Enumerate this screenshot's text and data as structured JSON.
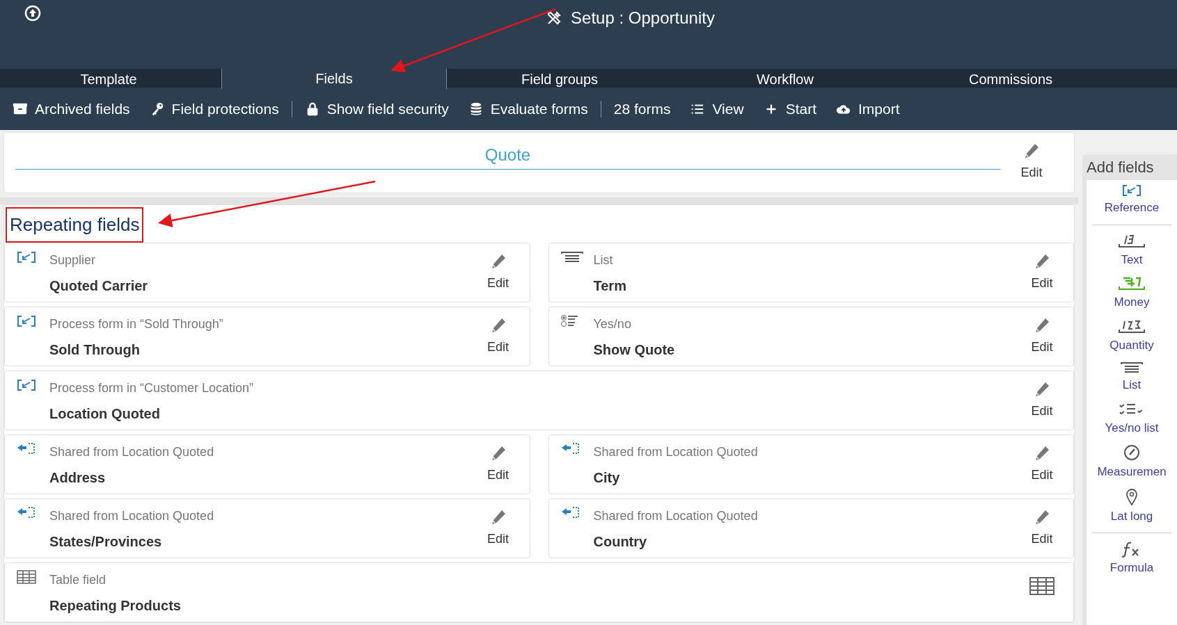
{
  "header": {
    "title": "Setup : Opportunity"
  },
  "tabs": [
    {
      "label": "Template",
      "selected": false
    },
    {
      "label": "Fields",
      "selected": true
    },
    {
      "label": "Field groups",
      "selected": false
    },
    {
      "label": "Workflow",
      "selected": false
    },
    {
      "label": "Commissions",
      "selected": false
    }
  ],
  "toolbar_groups": [
    [
      {
        "label": "Archived fields",
        "kind": "archive"
      },
      {
        "label": "Field protections",
        "kind": "key"
      }
    ],
    [
      {
        "label": "Show field security",
        "kind": "lock"
      },
      {
        "label": "Evaluate forms",
        "kind": "database"
      }
    ],
    [
      {
        "label": "28 forms",
        "kind": "count"
      },
      {
        "label": "View",
        "kind": "list"
      },
      {
        "label": "Start",
        "kind": "plus"
      },
      {
        "label": "Import",
        "kind": "cloud"
      }
    ]
  ],
  "quote_section": {
    "title": "Quote",
    "edit_label": "Edit"
  },
  "repeating_section": {
    "title": "Repeating fields",
    "highlighted": true,
    "fields": [
      {
        "kind": "reference",
        "type_label": "Supplier",
        "name": "Quoted Carrier",
        "edit_label": "Edit",
        "wide": false
      },
      {
        "kind": "list",
        "type_label": "List",
        "name": "Term",
        "edit_label": "Edit",
        "wide": false
      },
      {
        "kind": "reference",
        "type_label": "Process form in “Sold Through”",
        "name": "Sold Through",
        "edit_label": "Edit",
        "wide": false
      },
      {
        "kind": "yesno",
        "type_label": "Yes/no",
        "name": "Show Quote",
        "edit_label": "Edit",
        "wide": false
      },
      {
        "kind": "reference",
        "type_label": "Process form in “Customer Location”",
        "name": "Location Quoted",
        "edit_label": "Edit",
        "wide": true
      },
      {
        "kind": "shared",
        "type_label": "Shared from Location Quoted",
        "name": "Address",
        "edit_label": "Edit",
        "wide": false
      },
      {
        "kind": "shared",
        "type_label": "Shared from Location Quoted",
        "name": "City",
        "edit_label": "Edit",
        "wide": false
      },
      {
        "kind": "shared",
        "type_label": "Shared from Location Quoted",
        "name": "States/Provinces",
        "edit_label": "Edit",
        "wide": false
      },
      {
        "kind": "shared",
        "type_label": "Shared from Location Quoted",
        "name": "Country",
        "edit_label": "Edit",
        "wide": false
      },
      {
        "kind": "table",
        "type_label": "Table field",
        "name": "Repeating Products",
        "wide": true
      }
    ]
  },
  "sidebar": {
    "title": "Add fields",
    "groups": [
      [
        {
          "kind": "reference",
          "label": "Reference"
        }
      ],
      [
        {
          "kind": "text",
          "label": "Text"
        },
        {
          "kind": "money",
          "label": "Money"
        },
        {
          "kind": "quantity",
          "label": "Quantity"
        },
        {
          "kind": "list",
          "label": "List"
        },
        {
          "kind": "yesnolist",
          "label": "Yes/no list"
        },
        {
          "kind": "measurement",
          "label": "Measuremen"
        },
        {
          "kind": "latlong",
          "label": "Lat long"
        }
      ],
      [
        {
          "kind": "formula",
          "label": "Formula"
        }
      ]
    ]
  }
}
